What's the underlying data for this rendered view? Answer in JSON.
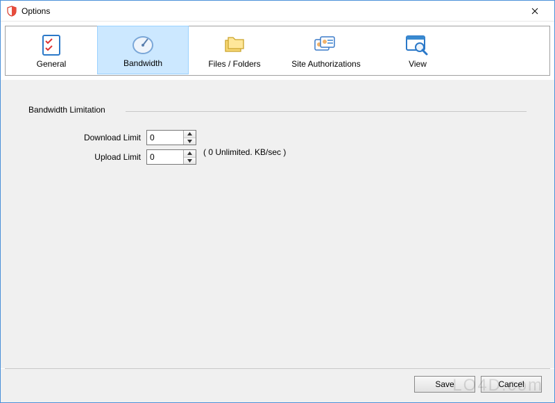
{
  "window": {
    "title": "Options"
  },
  "toolbar": {
    "items": [
      {
        "label": "General"
      },
      {
        "label": "Bandwidth"
      },
      {
        "label": "Files / Folders"
      },
      {
        "label": "Site Authorizations"
      },
      {
        "label": "View"
      }
    ],
    "selected_index": 1
  },
  "section": {
    "legend": "Bandwidth Limitation",
    "download_label": "Download Limit",
    "upload_label": "Upload Limit",
    "download_value": "0",
    "upload_value": "0",
    "hint": "( 0 Unlimited. KB/sec )"
  },
  "buttons": {
    "save": "Save",
    "cancel": "Cancel"
  },
  "watermark": "LO4D.com"
}
